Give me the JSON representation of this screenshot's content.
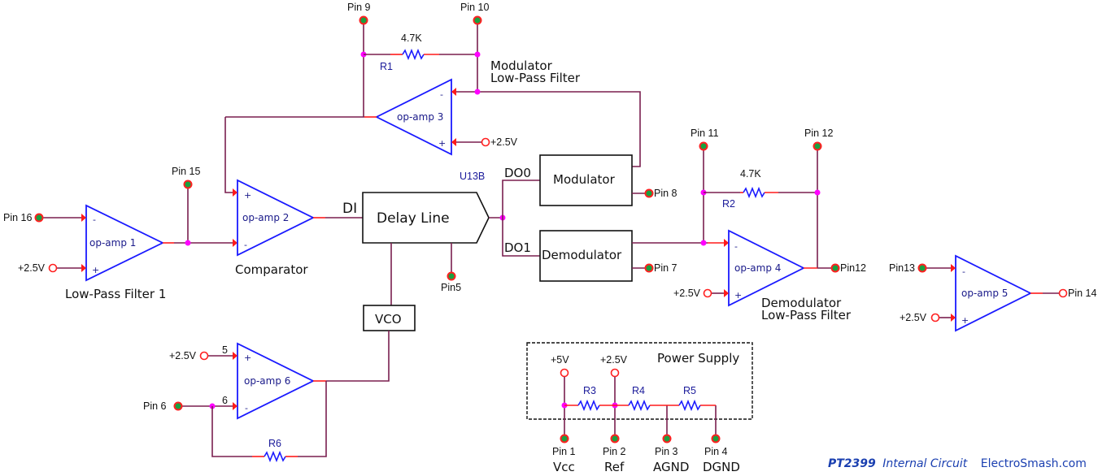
{
  "title": {
    "chip": "PT2399",
    "caption": "Internal Circuit",
    "site": "ElectroSmash.com"
  },
  "colors": {
    "wire": "#7a1f4f",
    "signal": "#ff1a1a",
    "opamp": "#1a1aff",
    "pin": "#1aa040",
    "junction": "#ff00ff",
    "footer": "#1a3fb0"
  },
  "opamps": {
    "op1": {
      "label": "op-amp 1",
      "caption": "Low-Pass Filter 1"
    },
    "op2": {
      "label": "op-amp 2",
      "caption": "Comparator"
    },
    "op3": {
      "label": "op-amp 3",
      "caption1": "Modulator",
      "caption2": "Low-Pass Filter"
    },
    "op4": {
      "label": "op-amp 4",
      "caption1": "Demodulator",
      "caption2": "Low-Pass Filter"
    },
    "op5": {
      "label": "op-amp 5"
    },
    "op6": {
      "label": "op-amp 6"
    }
  },
  "signs": {
    "minus": "-",
    "plus": "+"
  },
  "blocks": {
    "delay": "Delay Line",
    "modulator": "Modulator",
    "demodulator": "Demodulator",
    "vco": "VCO",
    "power": "Power Supply",
    "unit": "U13B"
  },
  "signals": {
    "di": "DI",
    "do0": "DO0",
    "do1": "DO1",
    "in5": "5",
    "in6": "6"
  },
  "resistors": {
    "r1": "R1",
    "r1_value": "4.7K",
    "r2": "R2",
    "r2_value": "4.7K",
    "r3": "R3",
    "r4": "R4",
    "r5": "R5",
    "r6": "R6"
  },
  "supply": {
    "v25": "+2.5V",
    "v5": "+5V"
  },
  "pins": {
    "p1": "Pin 1",
    "p1_name": "Vcc",
    "p2": "Pin 2",
    "p2_name": "Ref",
    "p3": "Pin 3",
    "p3_name": "AGND",
    "p4": "Pin 4",
    "p4_name": "DGND",
    "p5": "Pin5",
    "p6": "Pin 6",
    "p7": "Pin 7",
    "p8": "Pin 8",
    "p9": "Pin 9",
    "p10": "Pin 10",
    "p11": "Pin 11",
    "p12": "Pin 12",
    "p12b": "Pin12",
    "p13": "Pin13",
    "p14": "Pin 14",
    "p15": "Pin 15",
    "p16": "Pin 16"
  }
}
